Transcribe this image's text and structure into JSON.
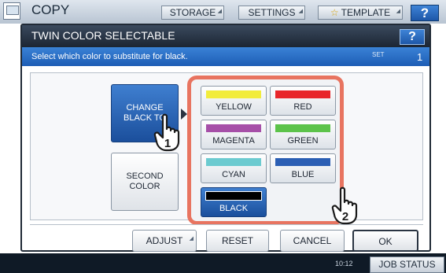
{
  "app": {
    "title": "COPY"
  },
  "top_tabs": [
    {
      "label": "STORAGE"
    },
    {
      "label": "SETTINGS"
    },
    {
      "label": "TEMPLATE"
    }
  ],
  "help_label": "?",
  "dialog": {
    "title": "TWIN COLOR SELECTABLE",
    "instruction": "Select which color to substitute for black.",
    "set_label": "SET",
    "set_value": "1"
  },
  "mode_buttons": {
    "change_black_to": "CHANGE BLACK TO",
    "second_color": "SECOND COLOR"
  },
  "colors": [
    {
      "label": "YELLOW",
      "swatch": "#f2ec3c"
    },
    {
      "label": "RED",
      "swatch": "#e8262a"
    },
    {
      "label": "MAGENTA",
      "swatch": "#a64fa8"
    },
    {
      "label": "GREEN",
      "swatch": "#5cc34a"
    },
    {
      "label": "CYAN",
      "swatch": "#6ccbd0"
    },
    {
      "label": "BLUE",
      "swatch": "#2b5fb4"
    },
    {
      "label": "BLACK",
      "swatch": "#000000",
      "selected": true
    }
  ],
  "actions": {
    "adjust": "ADJUST",
    "reset": "RESET",
    "cancel": "CANCEL",
    "ok": "OK"
  },
  "callouts": {
    "step1": "1",
    "step2": "2"
  },
  "status_bar": {
    "time": "10:12",
    "job_status": "JOB STATUS"
  },
  "accent_colors": {
    "highlight_frame": "#e87460",
    "selected_button": "#1b4f9c",
    "title_bar": "#1c2533",
    "instruction_bar": "#1d5db5"
  }
}
